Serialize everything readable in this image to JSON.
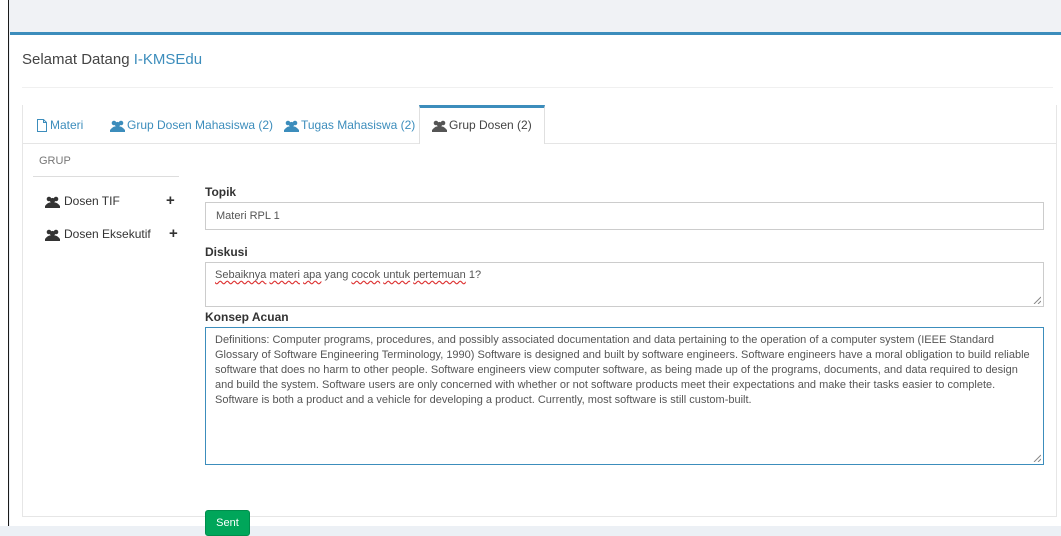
{
  "header": {
    "welcome": "Selamat Datang ",
    "brand": "I-KMSEdu"
  },
  "tabs": [
    {
      "label": "Materi",
      "icon": "file-icon"
    },
    {
      "label": "Grup Dosen Mahasiswa (2)",
      "icon": "users-icon"
    },
    {
      "label": "Tugas Mahasiswa (2)",
      "icon": "users-icon"
    },
    {
      "label": "Grup Dosen (2)",
      "icon": "users-icon",
      "active": true
    }
  ],
  "sidebar": {
    "heading": "GRUP",
    "items": [
      {
        "label": "Dosen TIF",
        "icon": "users-icon",
        "action": "+"
      },
      {
        "label": "Dosen Eksekutif",
        "icon": "users-icon",
        "action": "+"
      }
    ]
  },
  "form": {
    "topik_label": "Topik",
    "topik_value": "Materi RPL 1",
    "diskusi_label": "Diskusi",
    "diskusi_words": [
      "Sebaiknya",
      " ",
      "materi",
      " ",
      "apa",
      " yang ",
      "cocok",
      " ",
      "untuk",
      " ",
      "pertemuan",
      " 1?"
    ],
    "konsep_label": "Konsep Acuan",
    "konsep_value": "Definitions: Computer programs, procedures, and possibly associated documentation and data pertaining to the operation of a computer system (IEEE Standard Glossary of Software Engineering Terminology, 1990) Software is designed and built by software engineers. Software engineers have a moral obligation to build reliable software that does no harm to other people. Software engineers view computer software, as being made up of the programs, documents, and data required to design and build the system. Software users are only concerned with whether or not software products meet their expectations and make their tasks easier to complete. Software is both a product and a vehicle for developing a product. Currently, most software is still custom-built.",
    "submit_label": "Sent"
  },
  "colors": {
    "accent": "#3c8dbc",
    "success": "#00a65a"
  }
}
